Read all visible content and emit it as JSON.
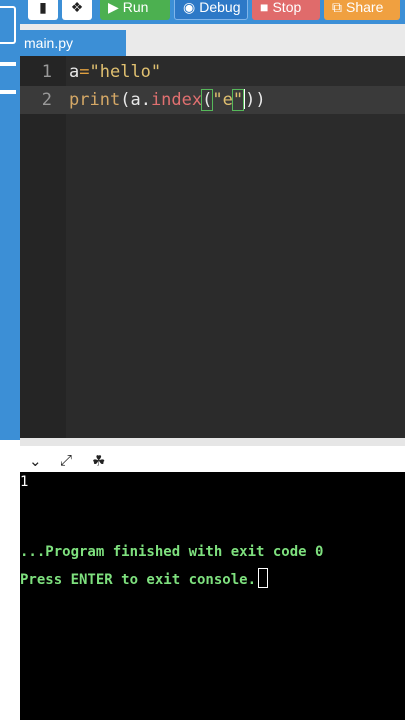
{
  "toolbar": {
    "run_label": "Run",
    "debug_label": "Debug",
    "stop_label": "Stop",
    "share_label": "Share",
    "colors": {
      "bar": "#3c8fd6",
      "run": "#4cb050",
      "stop": "#e06b6b",
      "share": "#f0a040"
    }
  },
  "tabs": [
    {
      "label": "main.py"
    }
  ],
  "editor": {
    "lines": [
      {
        "number": "1",
        "var": "a",
        "op": "=",
        "string": "\"hello\""
      },
      {
        "number": "2",
        "fn": "print",
        "open": "(",
        "obj": "a",
        "dot": ".",
        "method": "index",
        "paren": "(",
        "arg_open": "\"e",
        "arg_close": "\"",
        "close": "))"
      }
    ]
  },
  "console_toolbar": {
    "icons": [
      "chevron-down-icon",
      "expand-icon",
      "clear-console-icon"
    ]
  },
  "console": {
    "output": "1",
    "finish_message": "...Program finished with exit code 0",
    "exit_prompt": "Press ENTER to exit console."
  }
}
